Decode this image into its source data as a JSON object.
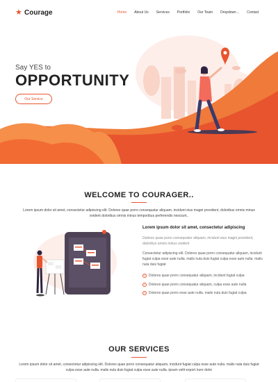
{
  "brand": {
    "name": "Courage",
    "logo_icon": "star-icon",
    "accent": "#e8542e"
  },
  "nav": {
    "items": [
      {
        "label": "Home",
        "active": true
      },
      {
        "label": "About Us"
      },
      {
        "label": "Services"
      },
      {
        "label": "Portfolio"
      },
      {
        "label": "Our Team"
      },
      {
        "label": "Dropdown",
        "has_chevron": true
      },
      {
        "label": "Contact"
      }
    ],
    "chevron": "⌄"
  },
  "hero": {
    "subtitle": "Say YES to",
    "title": "OPPORTUNITY",
    "button_label": "Our Service"
  },
  "welcome": {
    "title": "WELCOME TO COURAGER..",
    "description": "Lorem ipsum dolor sit amet, consectetur adipiscing elit. Dolores quae porro consequatur aliquam, incidunt eius magni provident, doloribus omnis minus ovident doloribus omnis minus temporibus perferendis nesciunt..",
    "content": {
      "heading": "Lorem ipsum dolor sit amet, consectetur adipiscing",
      "italic": "Dolores quae porro consequatur aliquam, incidunt eius magni provident, doloribus omnis minus ovident",
      "paragraph": "Consectetur adipiscing elit. Dolores quae porro consequatur aliquam, incidunt fugiat culpa esse aute nulla. malis nula duis fugiat culpa esse aute nulla. malis nula duis fugiat",
      "list": [
        "Dolores quae porro consequatur aliquam, incidunt fugiat culpa",
        "Dolores quae porro consequatur aliquam, culpa esse aute nulla",
        "Dolores quae porro esse aute nulla. malis nula duis fugiat culpa"
      ],
      "check_icon": "✓"
    }
  },
  "services": {
    "title": "OUR SERVICES",
    "description": "Lorem ipsum dolor sit amet, consectetur adipiscing elit. Dolores quae porro consequatur aliquam, incidunt fugiat culpa esse aute nulla. malis nula duis fugiat culpa esse aute nulla. malis nula duis fugiat culpa esse aute nulla. ipsum velit export irure dolor"
  }
}
